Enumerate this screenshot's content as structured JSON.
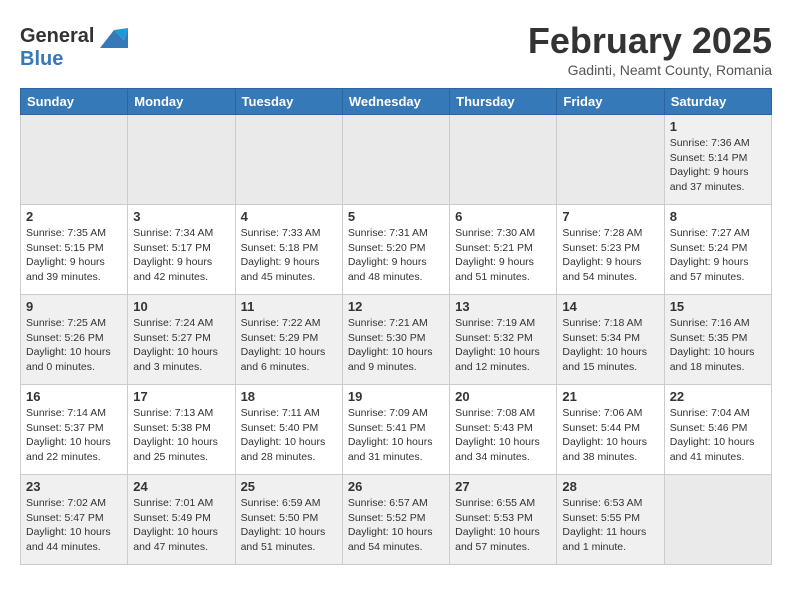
{
  "header": {
    "logo_line1": "General",
    "logo_line2": "Blue",
    "month_year": "February 2025",
    "location": "Gadinti, Neamt County, Romania"
  },
  "calendar": {
    "days_of_week": [
      "Sunday",
      "Monday",
      "Tuesday",
      "Wednesday",
      "Thursday",
      "Friday",
      "Saturday"
    ],
    "weeks": [
      [
        {
          "day": "",
          "info": ""
        },
        {
          "day": "",
          "info": ""
        },
        {
          "day": "",
          "info": ""
        },
        {
          "day": "",
          "info": ""
        },
        {
          "day": "",
          "info": ""
        },
        {
          "day": "",
          "info": ""
        },
        {
          "day": "1",
          "info": "Sunrise: 7:36 AM\nSunset: 5:14 PM\nDaylight: 9 hours and 37 minutes."
        }
      ],
      [
        {
          "day": "2",
          "info": "Sunrise: 7:35 AM\nSunset: 5:15 PM\nDaylight: 9 hours and 39 minutes."
        },
        {
          "day": "3",
          "info": "Sunrise: 7:34 AM\nSunset: 5:17 PM\nDaylight: 9 hours and 42 minutes."
        },
        {
          "day": "4",
          "info": "Sunrise: 7:33 AM\nSunset: 5:18 PM\nDaylight: 9 hours and 45 minutes."
        },
        {
          "day": "5",
          "info": "Sunrise: 7:31 AM\nSunset: 5:20 PM\nDaylight: 9 hours and 48 minutes."
        },
        {
          "day": "6",
          "info": "Sunrise: 7:30 AM\nSunset: 5:21 PM\nDaylight: 9 hours and 51 minutes."
        },
        {
          "day": "7",
          "info": "Sunrise: 7:28 AM\nSunset: 5:23 PM\nDaylight: 9 hours and 54 minutes."
        },
        {
          "day": "8",
          "info": "Sunrise: 7:27 AM\nSunset: 5:24 PM\nDaylight: 9 hours and 57 minutes."
        }
      ],
      [
        {
          "day": "9",
          "info": "Sunrise: 7:25 AM\nSunset: 5:26 PM\nDaylight: 10 hours and 0 minutes."
        },
        {
          "day": "10",
          "info": "Sunrise: 7:24 AM\nSunset: 5:27 PM\nDaylight: 10 hours and 3 minutes."
        },
        {
          "day": "11",
          "info": "Sunrise: 7:22 AM\nSunset: 5:29 PM\nDaylight: 10 hours and 6 minutes."
        },
        {
          "day": "12",
          "info": "Sunrise: 7:21 AM\nSunset: 5:30 PM\nDaylight: 10 hours and 9 minutes."
        },
        {
          "day": "13",
          "info": "Sunrise: 7:19 AM\nSunset: 5:32 PM\nDaylight: 10 hours and 12 minutes."
        },
        {
          "day": "14",
          "info": "Sunrise: 7:18 AM\nSunset: 5:34 PM\nDaylight: 10 hours and 15 minutes."
        },
        {
          "day": "15",
          "info": "Sunrise: 7:16 AM\nSunset: 5:35 PM\nDaylight: 10 hours and 18 minutes."
        }
      ],
      [
        {
          "day": "16",
          "info": "Sunrise: 7:14 AM\nSunset: 5:37 PM\nDaylight: 10 hours and 22 minutes."
        },
        {
          "day": "17",
          "info": "Sunrise: 7:13 AM\nSunset: 5:38 PM\nDaylight: 10 hours and 25 minutes."
        },
        {
          "day": "18",
          "info": "Sunrise: 7:11 AM\nSunset: 5:40 PM\nDaylight: 10 hours and 28 minutes."
        },
        {
          "day": "19",
          "info": "Sunrise: 7:09 AM\nSunset: 5:41 PM\nDaylight: 10 hours and 31 minutes."
        },
        {
          "day": "20",
          "info": "Sunrise: 7:08 AM\nSunset: 5:43 PM\nDaylight: 10 hours and 34 minutes."
        },
        {
          "day": "21",
          "info": "Sunrise: 7:06 AM\nSunset: 5:44 PM\nDaylight: 10 hours and 38 minutes."
        },
        {
          "day": "22",
          "info": "Sunrise: 7:04 AM\nSunset: 5:46 PM\nDaylight: 10 hours and 41 minutes."
        }
      ],
      [
        {
          "day": "23",
          "info": "Sunrise: 7:02 AM\nSunset: 5:47 PM\nDaylight: 10 hours and 44 minutes."
        },
        {
          "day": "24",
          "info": "Sunrise: 7:01 AM\nSunset: 5:49 PM\nDaylight: 10 hours and 47 minutes."
        },
        {
          "day": "25",
          "info": "Sunrise: 6:59 AM\nSunset: 5:50 PM\nDaylight: 10 hours and 51 minutes."
        },
        {
          "day": "26",
          "info": "Sunrise: 6:57 AM\nSunset: 5:52 PM\nDaylight: 10 hours and 54 minutes."
        },
        {
          "day": "27",
          "info": "Sunrise: 6:55 AM\nSunset: 5:53 PM\nDaylight: 10 hours and 57 minutes."
        },
        {
          "day": "28",
          "info": "Sunrise: 6:53 AM\nSunset: 5:55 PM\nDaylight: 11 hours and 1 minute."
        },
        {
          "day": "",
          "info": ""
        }
      ]
    ]
  }
}
